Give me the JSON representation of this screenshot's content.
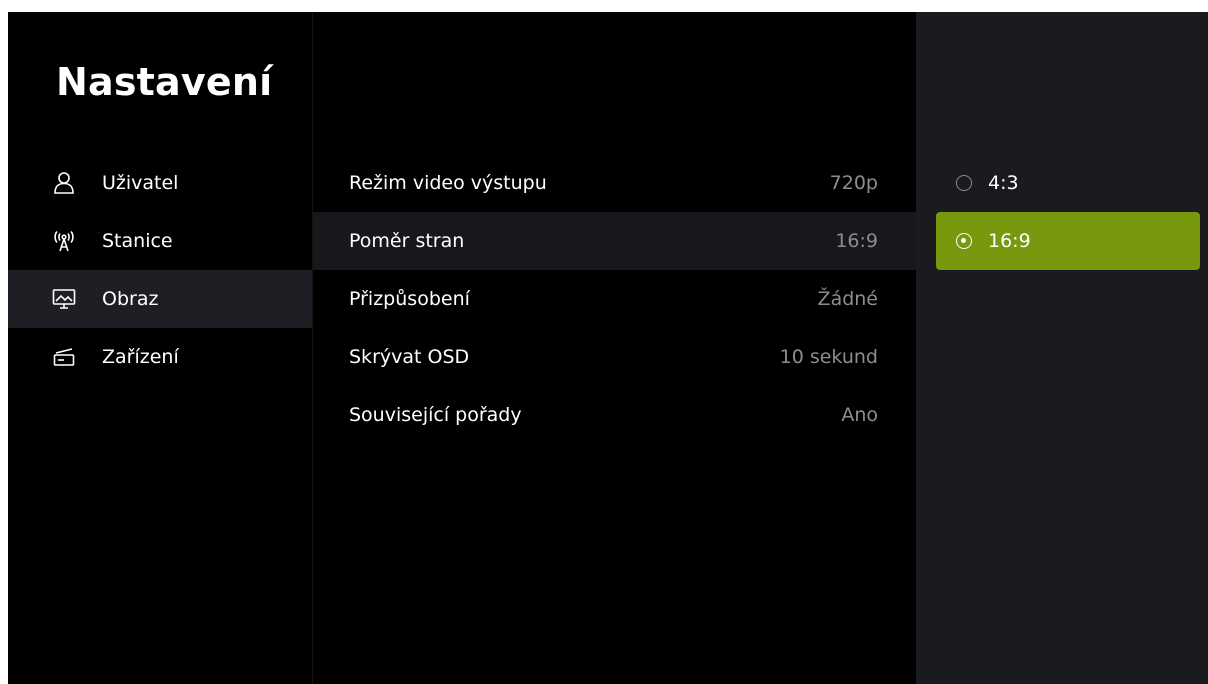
{
  "header": {
    "title": "Nastavení"
  },
  "sidebar": {
    "items": [
      {
        "label": "Uživatel",
        "icon": "user-icon",
        "active": false
      },
      {
        "label": "Stanice",
        "icon": "antenna-icon",
        "active": false
      },
      {
        "label": "Obraz",
        "icon": "picture-icon",
        "active": true
      },
      {
        "label": "Zařízení",
        "icon": "device-icon",
        "active": false
      }
    ]
  },
  "settings": {
    "rows": [
      {
        "label": "Režim video výstupu",
        "value": "720p"
      },
      {
        "label": "Poměr stran",
        "value": "16:9"
      },
      {
        "label": "Přizpůsobení",
        "value": "Žádné"
      },
      {
        "label": "Skrývat OSD",
        "value": "10 sekund"
      },
      {
        "label": "Související pořady",
        "value": "Ano"
      }
    ]
  },
  "options_panel": {
    "options": [
      {
        "label": "4:3",
        "selected": false
      },
      {
        "label": "16:9",
        "selected": true
      }
    ]
  },
  "colors": {
    "accent": "#78990e",
    "active_nav_bg": "#1d1f24",
    "panel_bg": "#1a1b1f",
    "value_text": "#8d8d8d"
  }
}
